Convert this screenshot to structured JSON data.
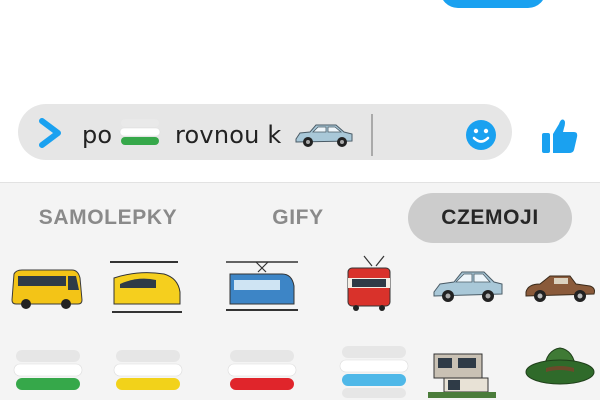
{
  "composer": {
    "text_before": "po",
    "text_after": "rovnou k",
    "embedded": [
      "czech-flag-stripes-sticker",
      "car-sticker"
    ]
  },
  "tabs": [
    {
      "label": "SAMOLEPKY",
      "active": false
    },
    {
      "label": "GIFY",
      "active": false
    },
    {
      "label": "CZEMOJI",
      "active": true
    }
  ],
  "stickers": {
    "row1": [
      "bus-icon",
      "high-speed-train-icon",
      "regional-train-icon",
      "tram-icon",
      "car-icon",
      "vintage-car-icon"
    ],
    "row2": [
      "green-stripes-icon",
      "yellow-stripes-icon",
      "red-stripes-icon",
      "blue-stripes-icon",
      "modern-house-icon",
      "green-hat-icon"
    ]
  },
  "colors": {
    "accent": "#1aa1f0",
    "composer_bg": "#e6e6e6",
    "panel_bg": "#f4f4f4",
    "active_tab_bg": "#cccccc"
  }
}
